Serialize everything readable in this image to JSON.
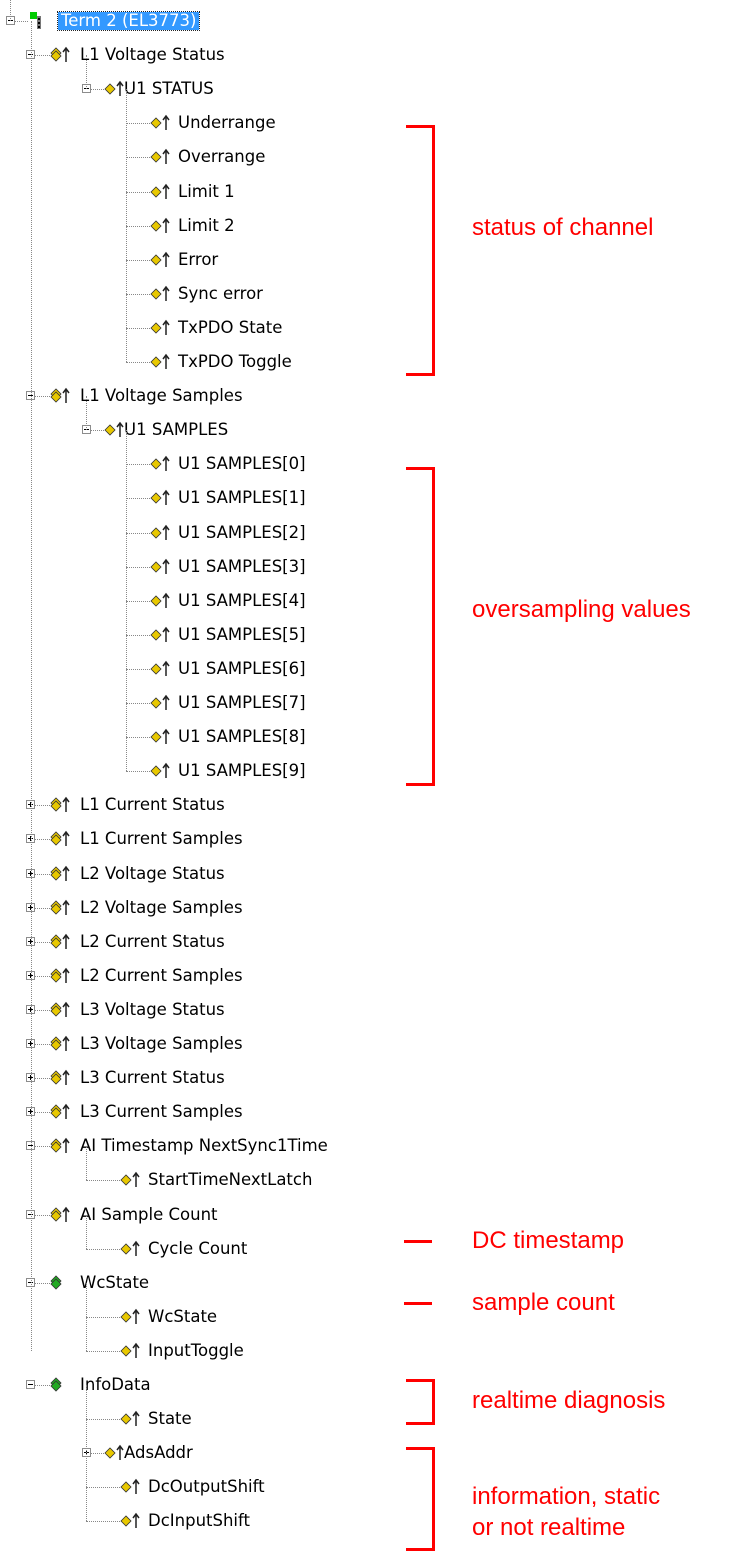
{
  "tree": {
    "root": "Term 2 (EL3773)",
    "nodes": [
      "L1 Voltage Status",
      "U1 STATUS",
      "Underrange",
      "Overrange",
      "Limit 1",
      "Limit 2",
      "Error",
      "Sync error",
      "TxPDO State",
      "TxPDO Toggle",
      "L1 Voltage Samples",
      "U1 SAMPLES",
      "U1 SAMPLES[0]",
      "U1 SAMPLES[1]",
      "U1 SAMPLES[2]",
      "U1 SAMPLES[3]",
      "U1 SAMPLES[4]",
      "U1 SAMPLES[5]",
      "U1 SAMPLES[6]",
      "U1 SAMPLES[7]",
      "U1 SAMPLES[8]",
      "U1 SAMPLES[9]",
      "L1 Current Status",
      "L1 Current Samples",
      "L2 Voltage Status",
      "L2 Voltage Samples",
      "L2 Current Status",
      "L2 Current Samples",
      "L3 Voltage Status",
      "L3 Voltage Samples",
      "L3 Current Status",
      "L3 Current Samples",
      "AI Timestamp NextSync1Time",
      "StartTimeNextLatch",
      "AI Sample Count",
      "Cycle Count",
      "WcState",
      "WcState",
      "InputToggle",
      "InfoData",
      "State",
      "AdsAddr",
      "DcOutputShift",
      "DcInputShift"
    ]
  },
  "annotations": {
    "status": "status of channel",
    "oversampling": "oversampling values",
    "dc": "DC timestamp",
    "count": "sample count",
    "diag": "realtime diagnosis",
    "info_1": "information, static",
    "info_2": "or not realtime"
  },
  "colors": {
    "annotation": "#ff0000",
    "selection": "#3399ff",
    "online": "#00cc00"
  }
}
